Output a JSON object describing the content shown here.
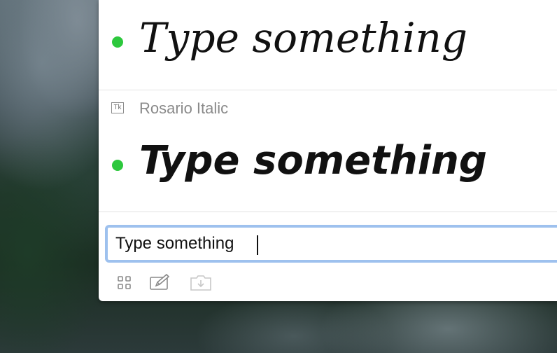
{
  "preview_rows": [
    {
      "text": "Type something"
    },
    {
      "font_name": "Rosario Italic",
      "font_icon": "Tk",
      "text": "Type something"
    }
  ],
  "input": {
    "value": "Type something",
    "placeholder": ""
  },
  "toolbar": {
    "icons": [
      "grid-icon",
      "edit-icon",
      "folder-download-icon"
    ]
  },
  "colors": {
    "accent_dot": "#2dc83d",
    "focus_ring": "#9ec1ee"
  }
}
